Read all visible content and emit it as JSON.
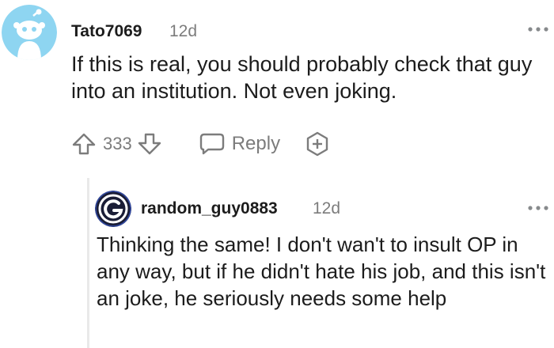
{
  "comments": [
    {
      "username": "Tato7069",
      "age": "12d",
      "more_icon": "more-horizontal-icon",
      "body": "If this is real, you should probably check that guy into an institution. Not even joking.",
      "score": "333",
      "reply_label": "Reply",
      "avatar_icon": "snoo-avatar-icon",
      "avatar_color": "#8ed5f1"
    },
    {
      "username": "random_guy0883",
      "age": "12d",
      "more_icon": "more-horizontal-icon",
      "body": "Thinking the same! I don't wan't to insult OP in any way, but if he didn't hate his job, and this isn't an joke, he seriously needs some help",
      "avatar_icon": "g-logo-avatar-icon",
      "avatar_color": "#1a1d36"
    }
  ],
  "colors": {
    "text": "#1c1c1c",
    "meta": "#7c7c7c",
    "icon": "#878a8c",
    "thread_line": "#e9e9e9"
  }
}
